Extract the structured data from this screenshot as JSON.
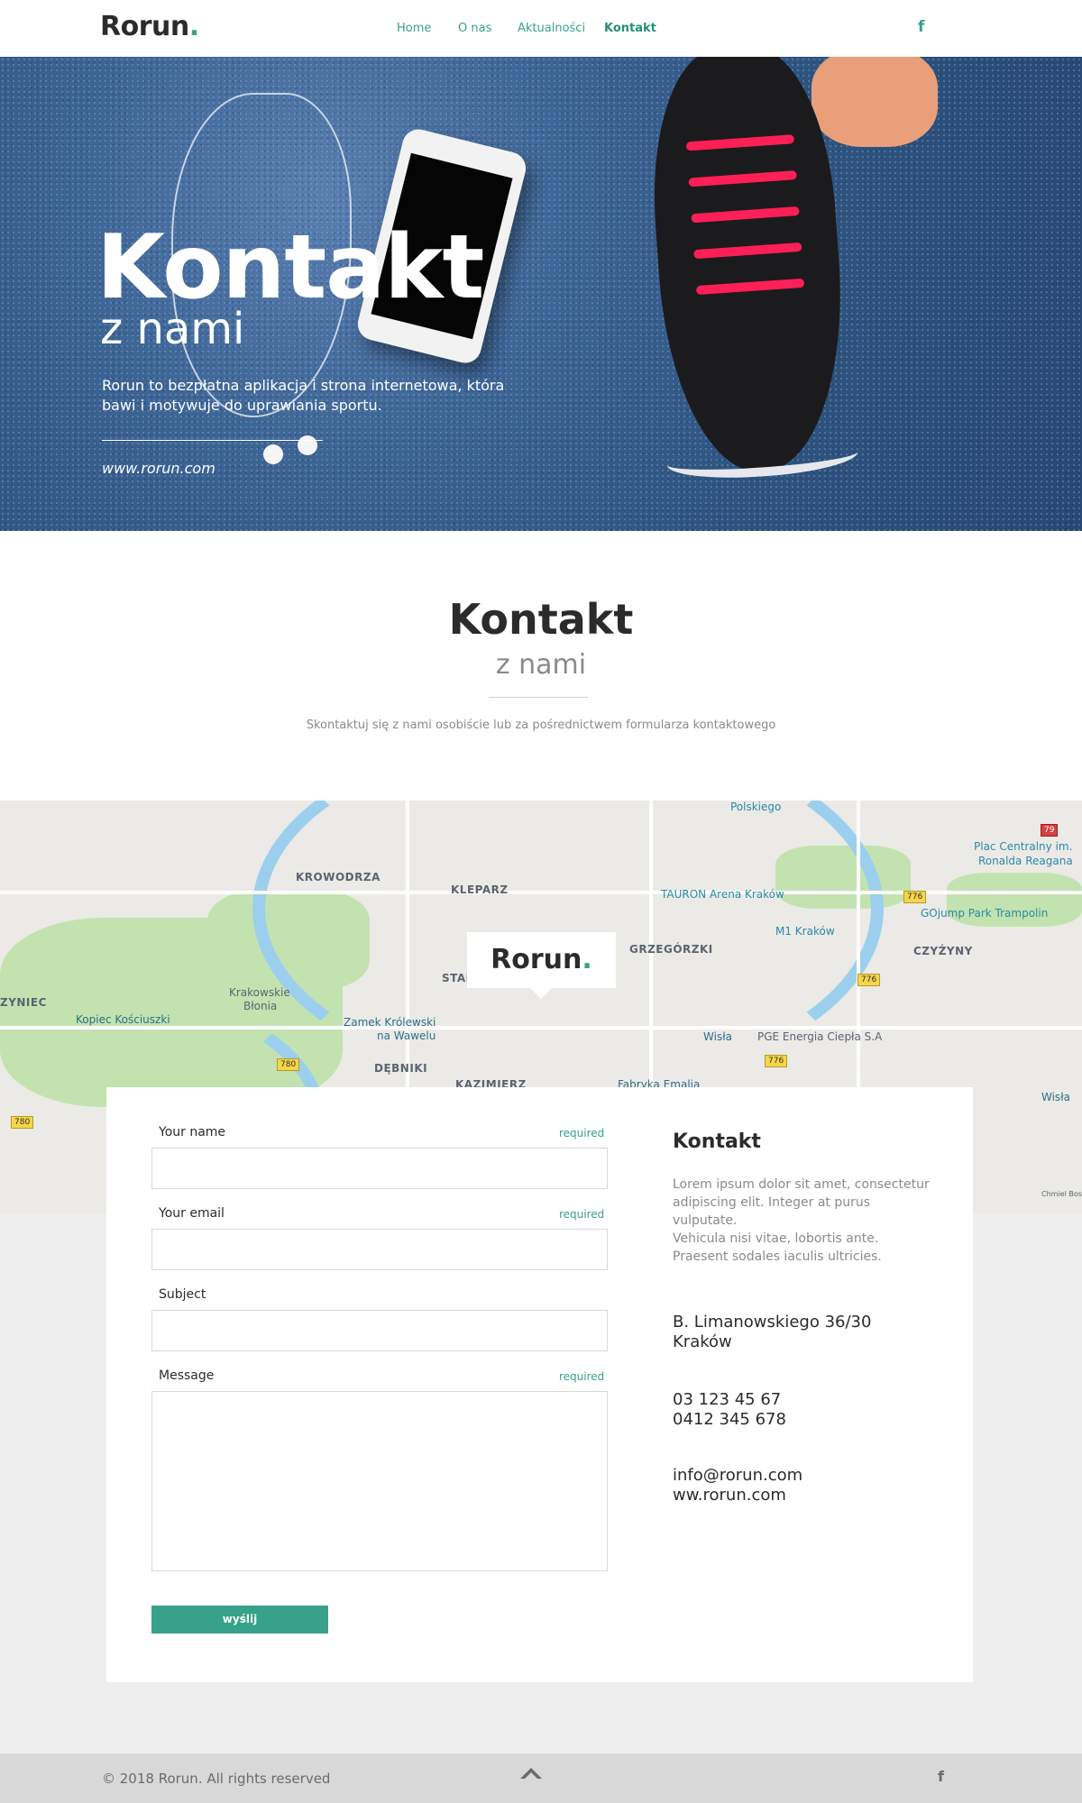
{
  "header": {
    "logo": "Rorun",
    "logo_dot": ".",
    "nav": [
      {
        "label": "Home"
      },
      {
        "label": "O nas"
      },
      {
        "label": "Aktualności"
      },
      {
        "label": "Kontakt"
      }
    ],
    "facebook_icon": "f"
  },
  "hero": {
    "title": "Kontakt",
    "subtitle": "z nami",
    "description": "Rorun to bezpłatna aplikacja i strona internetowa, która bawi i motywuje do uprawiania sportu.",
    "url": "www.rorun.com"
  },
  "section": {
    "title": "Kontakt",
    "subtitle": "z nami",
    "description": "Skontaktuj się z nami osobiście lub za pośrednictwem formularza kontaktowego"
  },
  "map": {
    "marker_logo": "Rorun",
    "marker_dot": ".",
    "labels": {
      "krowodrza": "KROWODRZA",
      "kleparz": "KLEPARZ",
      "grzegorzki": "GRZEGÓRZKI",
      "czyzyny": "CZYŻYNY",
      "debniki": "DĘBNIKI",
      "kazimierz": "KAZIMIERZ",
      "stare": "STAI",
      "zwierzyniec": "ZYNIEC",
      "polskiego": "Polskiego",
      "tauron": "TAURON Arena Kraków",
      "m1": "M1 Kraków",
      "gojump": "GOjump Park Trampolin",
      "plac": "Plac Centralny im.",
      "plac2": "Ronalda Reagana",
      "blonia": "Krakowskie",
      "blonia2": "Błonia",
      "kopiec": "Kopiec Kościuszki",
      "wawel": "Zamek Królewski",
      "wawel2": "na Wawelu",
      "pge": "PGE Energia Ciepła S.A",
      "fabryka": "Fabryka Emalia",
      "wisla": "Wisła",
      "wisla2": "Wisła",
      "chmiel": "Chmiel Bose"
    },
    "shields": [
      "776",
      "776",
      "776",
      "780",
      "780",
      "79"
    ]
  },
  "form": {
    "name_label": "Your name",
    "email_label": "Your email",
    "subject_label": "Subject",
    "message_label": "Message",
    "required": "required",
    "submit": "wyślij"
  },
  "contact": {
    "title": "Kontakt",
    "text1": "Lorem ipsum dolor sit amet, consectetur adipiscing elit. Integer at purus vulputate.",
    "text2": "Vehicula nisi vitae, lobortis ante. Praesent sodales iaculis ultricies.",
    "address1": "B. Limanowskiego 36/30",
    "address2": "Kraków",
    "phone1": "03 123 45 67",
    "phone2": "0412 345 678",
    "email": "info@rorun.com",
    "website": "ww.rorun.com"
  },
  "footer": {
    "copyright": "© 2018 Rorun. All rights reserved",
    "facebook_icon": "f"
  },
  "colors": {
    "accent": "#37a18a",
    "text_dark": "#2b2b2b",
    "text_grey": "#8a8a8a",
    "footer_bg": "#d8d8d8",
    "page_grey": "#eeeeee"
  }
}
